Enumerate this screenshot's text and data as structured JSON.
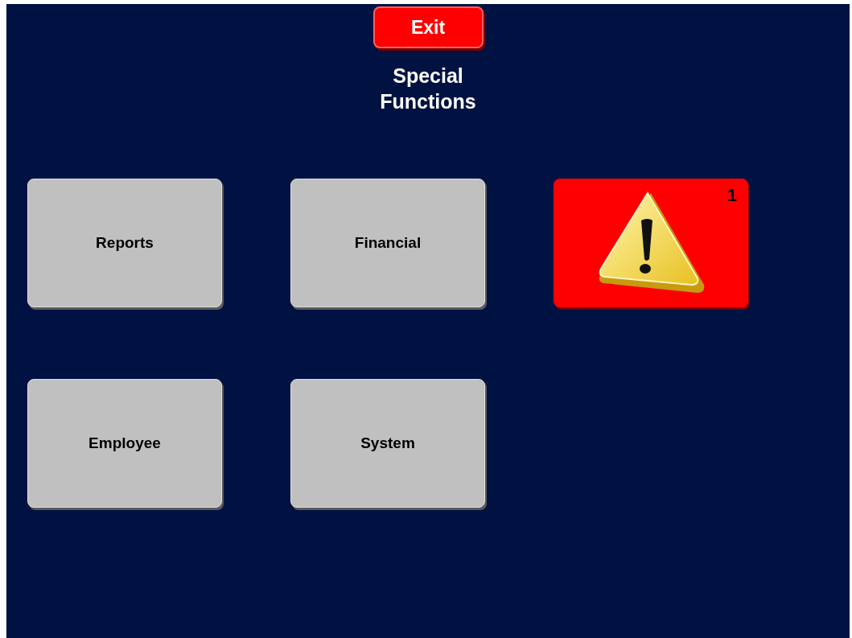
{
  "exit_button": {
    "label": "Exit"
  },
  "title": "Special Functions",
  "tiles": [
    {
      "kind": "label",
      "label": "Reports"
    },
    {
      "kind": "label",
      "label": "Financial"
    },
    {
      "kind": "alert",
      "count": "1"
    },
    {
      "kind": "label",
      "label": "Employee"
    },
    {
      "kind": "label",
      "label": "System"
    }
  ]
}
